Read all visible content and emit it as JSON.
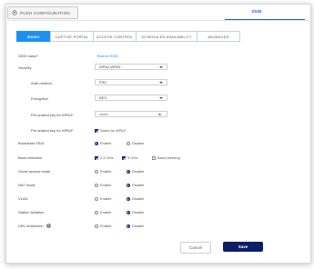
{
  "header": {
    "push_button_label": "PUSH CONFIGURATION",
    "top_tab_label": "SSID"
  },
  "tabs": [
    {
      "label": "BASIC",
      "active": true
    },
    {
      "label": "CAPTIVE PORTAL",
      "active": false
    },
    {
      "label": "ACCESS CONTROL",
      "active": false
    },
    {
      "label": "SCHEDULED AVAILABILITY",
      "active": false
    },
    {
      "label": "ADVANCED",
      "active": false
    }
  ],
  "form": {
    "ssid_name": {
      "label": "SSID name*",
      "value": "Branch SSID"
    },
    "security": {
      "label": "Security",
      "value": "WPA2-WPA3"
    },
    "auth_method": {
      "label": "Auth method",
      "value": "PSK"
    },
    "encryption": {
      "label": "Encryption",
      "value": "AES"
    },
    "psk_wpa2": {
      "label": "Pre-shared key for WPA2*",
      "value": "•••••••"
    },
    "psk_wpa3": {
      "label": "Pre-shared key for WPA3*",
      "checkbox_label": "Same as WPA2",
      "checked": true
    },
    "broadcast_ssid": {
      "label": "Broadcast SSID",
      "options": [
        "Enable",
        "Disable"
      ],
      "selected": "Enable"
    },
    "band_selection": {
      "label": "Band selection",
      "options": [
        "2.4 GHz",
        "5 GHz",
        "Band steering"
      ],
      "checked": [
        true,
        true,
        false
      ]
    },
    "guest_access": {
      "label": "Guest access mode",
      "options": [
        "Enable",
        "Disable"
      ],
      "selected": "Disable"
    },
    "nat_mode": {
      "label": "NAT mode",
      "options": [
        "Enable",
        "Disable"
      ],
      "selected": "Disable"
    },
    "vlan": {
      "label": "VLAN",
      "options": [
        "Enable",
        "Disable"
      ],
      "selected": "Disable"
    },
    "station_isolation": {
      "label": "Station isolation",
      "options": [
        "Enable",
        "Disable"
      ],
      "selected": "Disable"
    },
    "url_redirection": {
      "label": "URL redirection",
      "options": [
        "Enable",
        "Disable"
      ],
      "selected": "Disable"
    }
  },
  "footer": {
    "cancel_label": "Cancel",
    "save_label": "Save"
  },
  "colors": {
    "accent": "#1d8ff0",
    "primary_button": "#0b1f66",
    "radio_selected": "#0a2a7a"
  },
  "icons": {
    "push": "push-config-icon",
    "eye": "eye-icon",
    "info": "info-icon"
  }
}
